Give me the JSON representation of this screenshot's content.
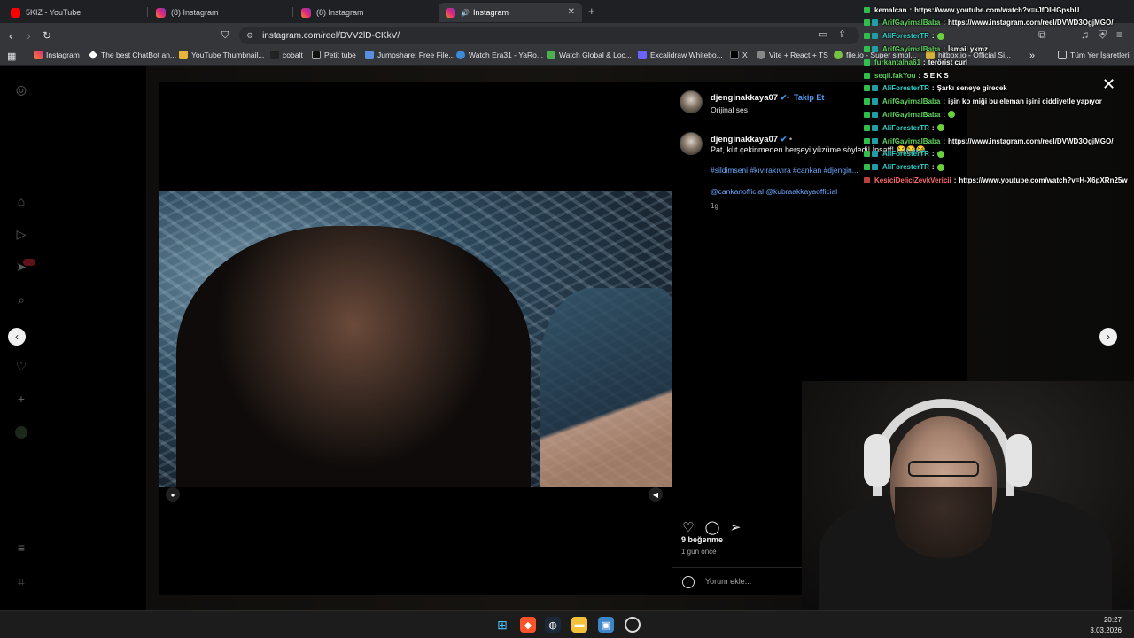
{
  "browser": {
    "tabs": [
      {
        "label": "5KIZ - YouTube",
        "active": false
      },
      {
        "label": "(8) Instagram",
        "active": false
      },
      {
        "label": "(8) Instagram",
        "active": false
      },
      {
        "label": "Instagram",
        "active": true
      }
    ],
    "url": "instagram.com/reel/DVV2lD-CKkV/",
    "bookmarks": [
      "Instagram",
      "The best ChatBot an...",
      "YouTube Thumbnail...",
      "cobalt",
      "Petit tube",
      "Jumpshare: Free File...",
      "Watch Era31 - YaRo...",
      "Watch Global & Loc...",
      "Excalidraw Whitebo...",
      "X",
      "Vite + React + TS",
      "file.io - Super simpl...",
      "hitbox.io - Official Si..."
    ],
    "bookmarks_more": "»",
    "all_bookmarks": "Tüm Yer İşaretleri"
  },
  "post": {
    "username": "djenginakkaya07",
    "verified_mark": "✔",
    "follow_label": "Takip Et",
    "audio": "Orijinal ses",
    "caption_user": "djenginakkaya07",
    "caption_dash": "•",
    "caption_text": "Pat, küt çekinmeden herşeyi yüzüme söyledi! İnsaff! 😂😂😂",
    "hashtags": "#sildimseni #kıvırakıvıra #cankan #djengin...",
    "mentions": "@cankanofficial @kubraakkayaofficial",
    "caption_age": "1g",
    "likes": "9 beğenme",
    "time_ago": "1 gün önce",
    "comment_placeholder": "Yorum ekle..."
  },
  "chat": [
    {
      "name": "kemalcan",
      "color": "#ffffff",
      "badges": [
        "g"
      ],
      "msg": "https://www.youtube.com/watch?v=rJfDIHGpsbU"
    },
    {
      "name": "ArifGayirnalBaba",
      "color": "#5fd35f",
      "badges": [
        "g",
        "t"
      ],
      "msg": "https://www.instagram.com/reel/DVWD3OgjMGO/"
    },
    {
      "name": "AliForesterTR",
      "color": "#2fd0c8",
      "badges": [
        "g",
        "t"
      ],
      "msg": "",
      "emote": true
    },
    {
      "name": "ArifGayirnalBaba",
      "color": "#5fd35f",
      "badges": [
        "g",
        "t"
      ],
      "msg": "İsmail ykmz"
    },
    {
      "name": "furkantalha61",
      "color": "#5fd35f",
      "badges": [
        "g"
      ],
      "msg": "terörist curl"
    },
    {
      "name": "seqil.fakYou",
      "color": "#5fd35f",
      "badges": [
        "g"
      ],
      "msg": "S E K S"
    },
    {
      "name": "AliForesterTR",
      "color": "#2fd0c8",
      "badges": [
        "g",
        "t"
      ],
      "msg": "Şarkı seneye girecek"
    },
    {
      "name": "ArifGayirnalBaba",
      "color": "#5fd35f",
      "badges": [
        "g",
        "t"
      ],
      "msg": "işin ko miği bu eleman işini ciddiyetle yapıyor"
    },
    {
      "name": "ArifGayirnalBaba",
      "color": "#5fd35f",
      "badges": [
        "g",
        "t"
      ],
      "msg": "",
      "emote": true
    },
    {
      "name": "AliForesterTR",
      "color": "#2fd0c8",
      "badges": [
        "g",
        "t"
      ],
      "msg": "",
      "emote": true
    },
    {
      "name": "ArifGayirnalBaba",
      "color": "#5fd35f",
      "badges": [
        "g",
        "t"
      ],
      "msg": "https://www.instagram.com/reel/DVWD3OgjMGO/"
    },
    {
      "name": "AliForesterTR",
      "color": "#2fd0c8",
      "badges": [
        "g",
        "t"
      ],
      "msg": "",
      "emote": true
    },
    {
      "name": "AliForesterTR",
      "color": "#2fd0c8",
      "badges": [
        "g",
        "t"
      ],
      "msg": "",
      "emote": true
    },
    {
      "name": "KesiciDeliciZevkVericii",
      "color": "#ff6b6b",
      "badges": [
        "r"
      ],
      "msg": "https://www.youtube.com/watch?v=H-X6pXRn25w"
    }
  ],
  "taskbar": {
    "time": "20:27",
    "date": "3.03.2026"
  },
  "colors": {
    "accent": "#4f9cf6",
    "tag": "#6ba9ff"
  }
}
